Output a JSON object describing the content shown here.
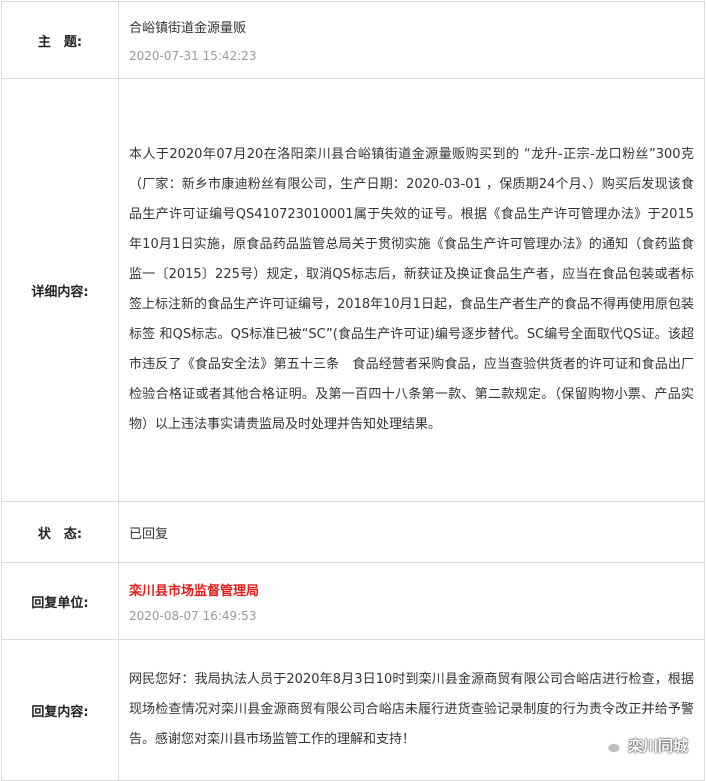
{
  "subject": {
    "label": "主　题:",
    "title": "合峪镇街道金源量贩",
    "date": "2020-07-31 15:42:23"
  },
  "detail": {
    "label": "详细内容:",
    "text": "本人于2020年07月20在洛阳栾川县合峪镇街道金源量贩购买到的 “龙升-正宗-龙口粉丝”300克（厂家：新乡市康迪粉丝有限公司，生产日期：2020-03-01 ，保质期24个月、）购买后发现该食品生产许可证编号QS410723010001属于失效的证号。根据《食品生产许可管理办法》于2015年10月1日实施，原食品药品监管总局关于贯彻实施《食品生产许可管理办法》的通知（食药监食监一〔2015〕225号）规定，取消QS标志后，新获证及换证食品生产者，应当在食品包装或者标签上标注新的食品生产许可证编号，2018年10月1日起，食品生产者生产的食品不得再使用原包装标签 和QS标志。QS标准已被“SC”(食品生产许可证)编号逐步替代。SC编号全面取代QS证。该超市违反了《食品安全法》第五十三条　食品经营者采购食品，应当查验供货者的许可证和食品出厂检验合格证或者其他合格证明。及第一百四十八条第一款、第二款规定。（保留购物小票、产品实物）以上违法事实请贵监局及时处理并告知处理结果。"
  },
  "status": {
    "label": "状　态:",
    "value": "已回复"
  },
  "reply_unit": {
    "label": "回复单位:",
    "name": "栾川县市场监督管理局",
    "date": "2020-08-07 16:49:53",
    "name_color": "#e0201c"
  },
  "reply": {
    "label": "回复内容:",
    "text": "网民您好：我局执法人员于2020年8月3日10时到栾川县金源商贸有限公司合峪店进行检查，根据现场检查情况对栾川县金源商贸有限公司合峪店未履行进货查验记录制度的行为责令改正并给予警告。感谢您对栾川县市场监管工作的理解和支持！"
  },
  "watermark": {
    "text": "栾川同城",
    "icon": "wechat-icon"
  }
}
